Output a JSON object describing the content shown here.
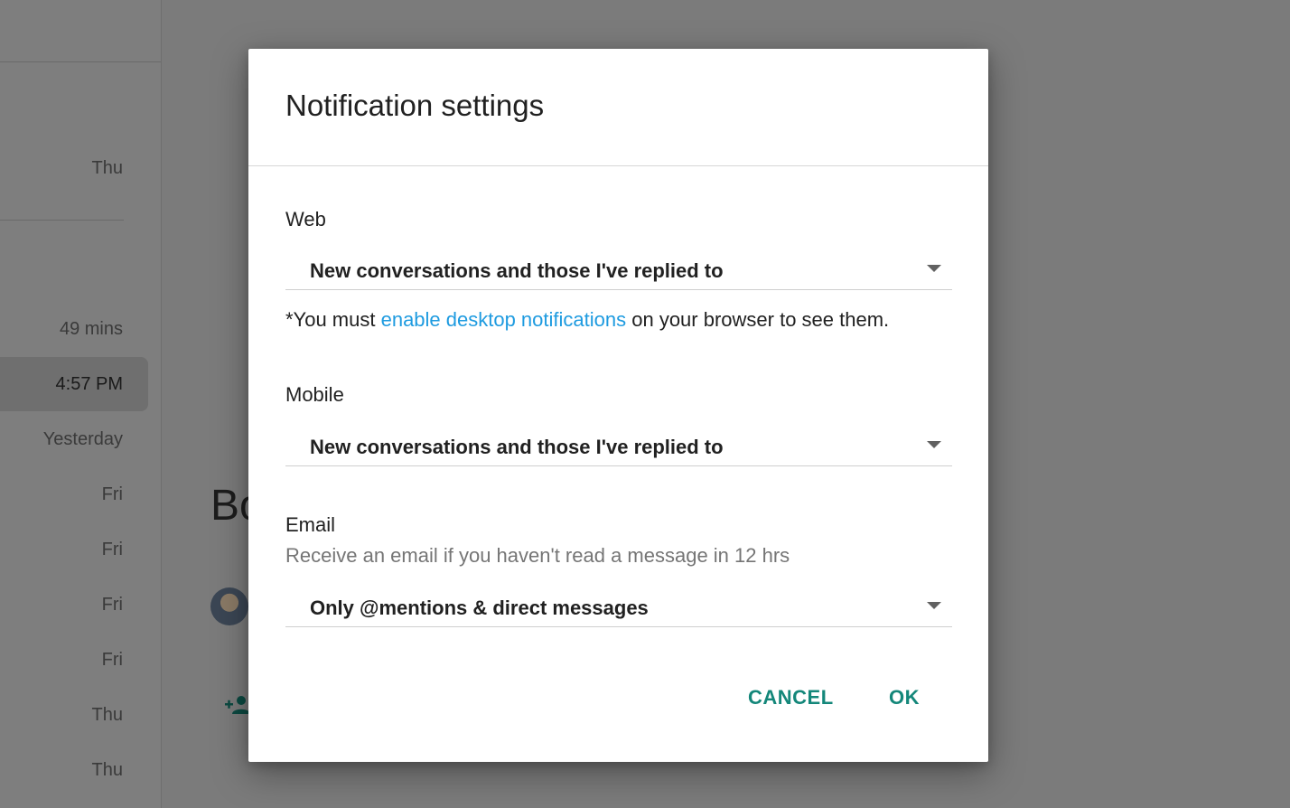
{
  "background": {
    "sidebar_times": [
      "Thu",
      "49 mins",
      "4:57 PM",
      "Yesterday",
      "Fri",
      "Fri",
      "Fri",
      "Fri",
      "Thu",
      "Thu"
    ],
    "partial_title": "Bo"
  },
  "dialog": {
    "title": "Notification settings",
    "web": {
      "label": "Web",
      "value": "New conversations and those I've replied to",
      "note_prefix": "*You must ",
      "note_link": "enable desktop notifications",
      "note_suffix": " on your browser to see them."
    },
    "mobile": {
      "label": "Mobile",
      "value": "New conversations and those I've replied to"
    },
    "email": {
      "label": "Email",
      "hint": "Receive an email if you haven't read a message in 12 hrs",
      "value": "Only @mentions & direct messages"
    },
    "buttons": {
      "cancel": "CANCEL",
      "ok": "OK"
    }
  },
  "colors": {
    "accent": "#14877a",
    "link": "#1e9be0",
    "overlay": "#7b7b7b"
  }
}
